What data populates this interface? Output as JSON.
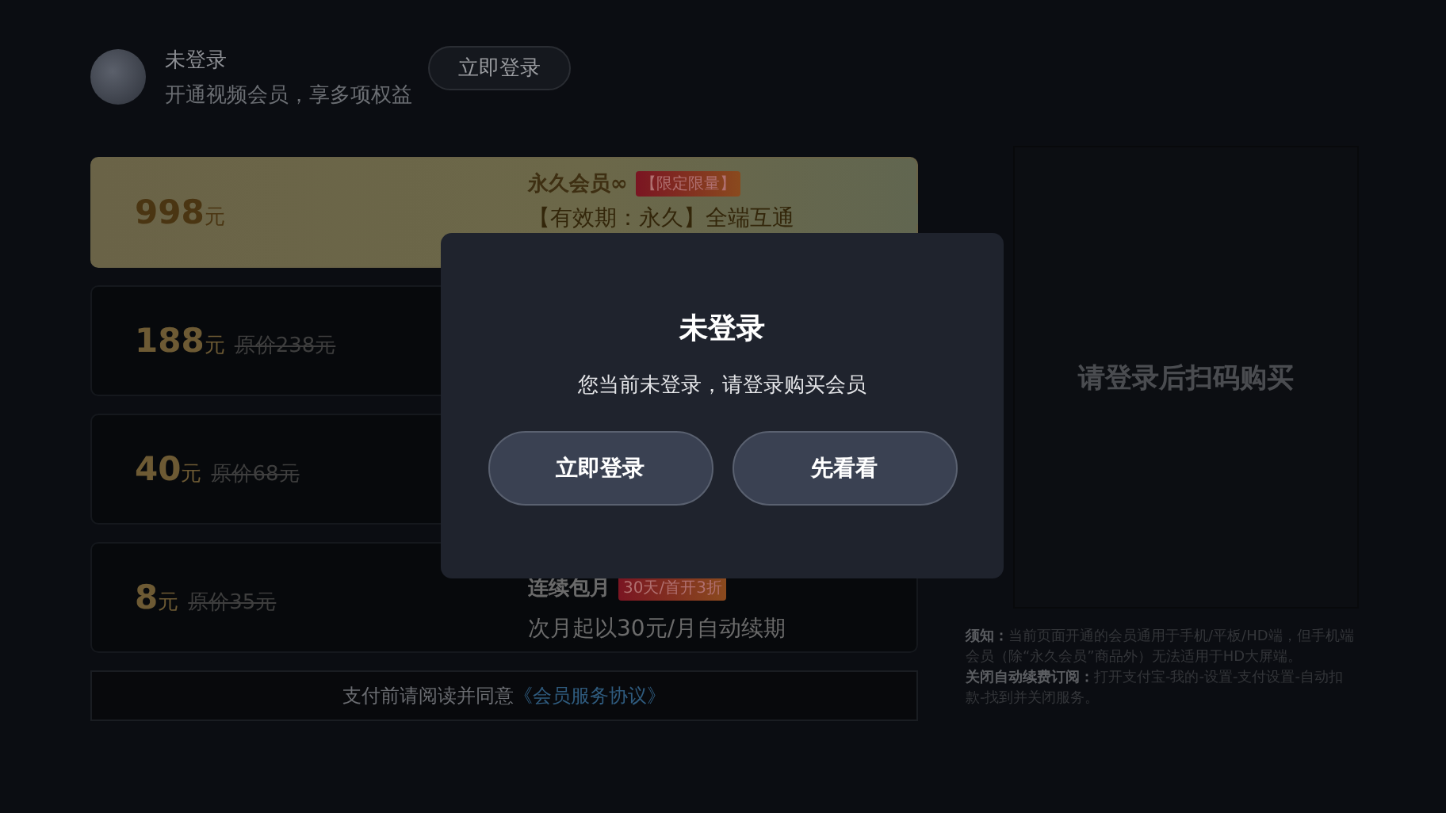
{
  "user": {
    "name": "未登录",
    "subtitle": "开通视频会员，享多项权益",
    "login_button": "立即登录"
  },
  "plans": [
    {
      "price": "998",
      "unit": "元",
      "selected": true,
      "title": "永久会员∞",
      "badge": "【限定限量】",
      "description": "【有效期：永久】全端互通"
    },
    {
      "price": "188",
      "unit": "元",
      "original_price": "原价238元",
      "selected": false
    },
    {
      "price": "40",
      "unit": "元",
      "original_price": "原价68元",
      "selected": false
    },
    {
      "price": "8",
      "unit": "元",
      "original_price": "原价35元",
      "selected": false,
      "title": "连续包月",
      "badge": "30天/首开3折",
      "description": "次月起以30元/月自动续期"
    }
  ],
  "agreement": {
    "text": "支付前请阅读并同意",
    "link": "《会员服务协议》"
  },
  "qr_panel": {
    "message": "请登录后扫码购买"
  },
  "notes": [
    "**须知：**当前页面开通的会员通用于手机/平板/HD端，但手机端会员（除“永久会员”商品外）无法适用于HD大屏端。",
    "**关闭自动续费订阅：**打开支付宝-我的-设置-支付设置-自动扣款-找到并关闭服务。"
  ],
  "dialog": {
    "title": "未登录",
    "message": "您当前未登录，请登录购买会员",
    "buttons": [
      "立即登录",
      "先看看"
    ]
  }
}
